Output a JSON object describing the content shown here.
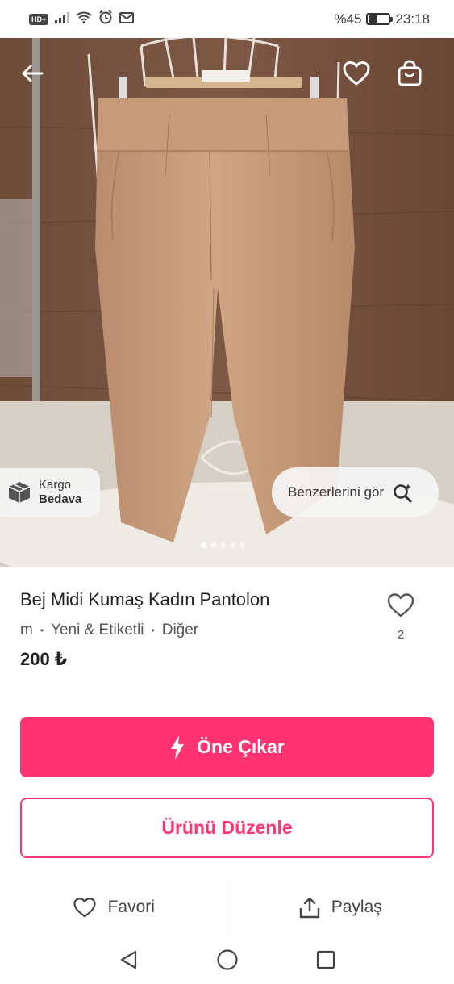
{
  "status_bar": {
    "hd": "HD+",
    "battery_text": "%45",
    "battery_level": 0.45,
    "time": "23:18",
    "icons": [
      "hd-icon",
      "signal-icon",
      "wifi-icon",
      "alarm-icon",
      "mail-icon",
      "battery-icon"
    ]
  },
  "header": {
    "icons": [
      "back-arrow-icon",
      "heart-icon",
      "shopping-bag-icon"
    ]
  },
  "hero": {
    "cargo_line1": "Kargo",
    "cargo_line2": "Bedava",
    "similar_label": "Benzerlerini gör",
    "page_count": 5,
    "active_page": 1
  },
  "product": {
    "title": "Bej Midi Kumaş Kadın Pantolon",
    "size": "m",
    "condition": "Yeni & Etiketli",
    "brand": "Diğer",
    "separator": "•",
    "price": "200 ₺",
    "like_count": "2"
  },
  "buttons": {
    "promote_label": "Öne Çıkar",
    "edit_label": "Ürünü Düzenle"
  },
  "actions": {
    "favorite_label": "Favori",
    "share_label": "Paylaş"
  },
  "colors": {
    "accent": "#ff3371",
    "pant": "#c9a07f"
  }
}
